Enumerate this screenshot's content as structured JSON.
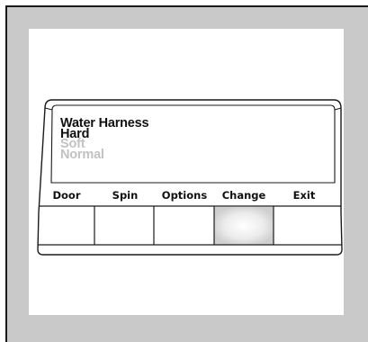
{
  "display": {
    "lines": [
      {
        "text": "Water Harness",
        "state": "title"
      },
      {
        "text": "Hard",
        "state": "selected"
      },
      {
        "text": "Soft",
        "state": "dim"
      },
      {
        "text": "Normal",
        "state": "dim"
      }
    ]
  },
  "buttons": [
    {
      "label": "Door",
      "pressed": false
    },
    {
      "label": "Spin",
      "pressed": false
    },
    {
      "label": "Options",
      "pressed": false
    },
    {
      "label": "Change",
      "pressed": true
    },
    {
      "label": "Exit",
      "pressed": false
    }
  ]
}
